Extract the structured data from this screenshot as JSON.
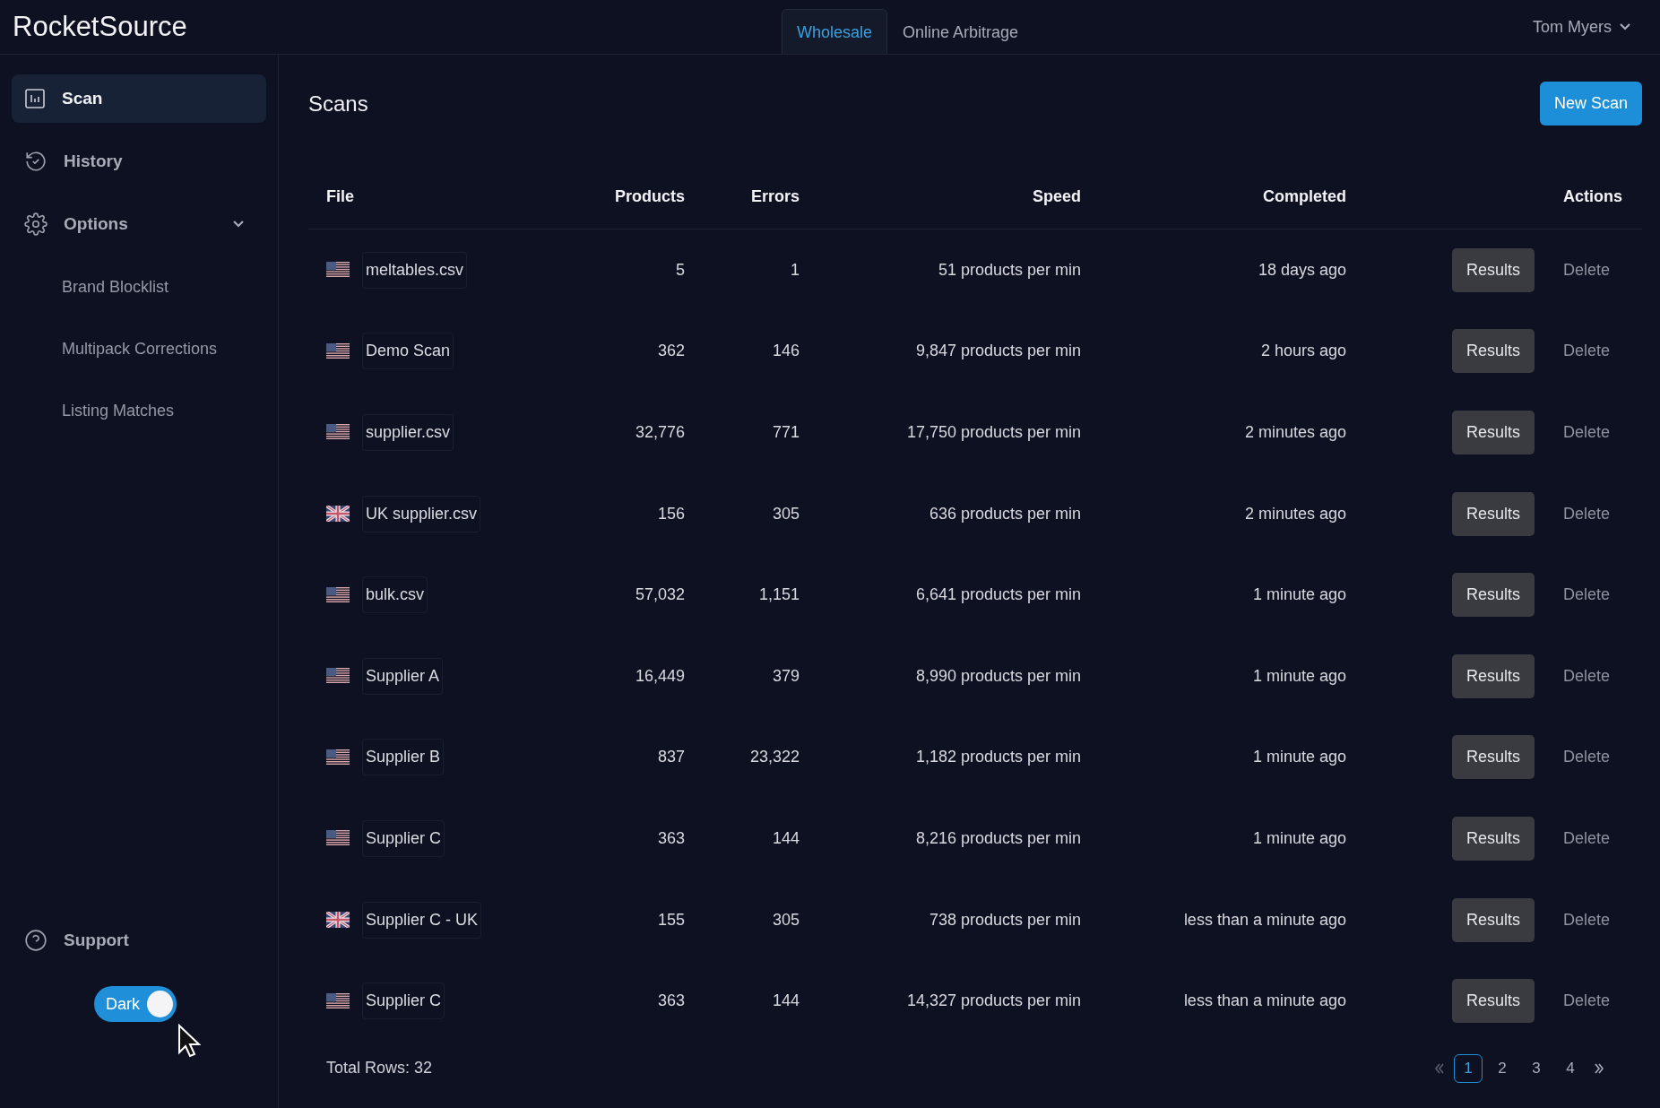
{
  "brand": "RocketSource",
  "tabs": [
    {
      "label": "Wholesale",
      "selected": true
    },
    {
      "label": "Online Arbitrage",
      "selected": false
    }
  ],
  "user": {
    "name": "Tom Myers"
  },
  "sidebar": {
    "items": [
      {
        "label": "Scan",
        "selected": true
      },
      {
        "label": "History",
        "selected": false
      },
      {
        "label": "Options",
        "selected": false,
        "expanded": true,
        "children": [
          {
            "label": "Brand Blocklist"
          },
          {
            "label": "Multipack Corrections"
          },
          {
            "label": "Listing Matches"
          }
        ]
      }
    ],
    "support": {
      "label": "Support"
    },
    "theme_toggle": {
      "label": "Dark",
      "on": true
    }
  },
  "page": {
    "title": "Scans",
    "new_button": "New Scan"
  },
  "table": {
    "columns": [
      "File",
      "Products",
      "Errors",
      "Speed",
      "Completed",
      "Actions"
    ],
    "rows": [
      {
        "kind": "us",
        "file": "meltables.csv",
        "products": "5",
        "errors": "1",
        "speed": "51 products per min",
        "completed": "18 days ago",
        "actions": [
          "Results",
          "Delete"
        ]
      },
      {
        "kind": "us",
        "file": "Demo Scan",
        "products": "362",
        "errors": "146",
        "speed": "9,847 products per min",
        "completed": "2 hours ago",
        "actions": [
          "Results",
          "Delete"
        ]
      },
      {
        "kind": "us",
        "file": "supplier.csv",
        "products": "32,776",
        "errors": "771",
        "speed": "17,750 products per min",
        "completed": "2 minutes ago",
        "actions": [
          "Results",
          "Delete"
        ]
      },
      {
        "kind": "uk",
        "file": "UK supplier.csv",
        "products": "156",
        "errors": "305",
        "speed": "636 products per min",
        "completed": "2 minutes ago",
        "actions": [
          "Results",
          "Delete"
        ]
      },
      {
        "kind": "us",
        "file": "bulk.csv",
        "products": "57,032",
        "errors": "1,151",
        "speed": "6,641 products per min",
        "completed": "1 minute ago",
        "actions": [
          "Results",
          "Delete"
        ]
      },
      {
        "kind": "us",
        "file": "Supplier A",
        "products": "16,449",
        "errors": "379",
        "speed": "8,990 products per min",
        "completed": "1 minute ago",
        "actions": [
          "Results",
          "Delete"
        ]
      },
      {
        "kind": "us",
        "file": "Supplier B",
        "products": "837",
        "errors": "23,322",
        "speed": "1,182 products per min",
        "completed": "1 minute ago",
        "actions": [
          "Results",
          "Delete"
        ]
      },
      {
        "kind": "us",
        "file": "Supplier C",
        "products": "363",
        "errors": "144",
        "speed": "8,216 products per min",
        "completed": "1 minute ago",
        "actions": [
          "Results",
          "Delete"
        ]
      },
      {
        "kind": "uk",
        "file": "Supplier C - UK",
        "products": "155",
        "errors": "305",
        "speed": "738 products per min",
        "completed": "less than a minute ago",
        "actions": [
          "Results",
          "Delete"
        ]
      },
      {
        "kind": "us",
        "file": "Supplier C",
        "products": "363",
        "errors": "144",
        "speed": "14,327 products per min",
        "completed": "less than a minute ago",
        "actions": [
          "Results",
          "Delete"
        ]
      }
    ],
    "total": "Total Rows: 32"
  },
  "pagination": {
    "pages": [
      {
        "label": "1",
        "selected": true
      },
      {
        "label": "2",
        "selected": false
      },
      {
        "label": "3",
        "selected": false
      },
      {
        "label": "4",
        "selected": false
      }
    ]
  }
}
